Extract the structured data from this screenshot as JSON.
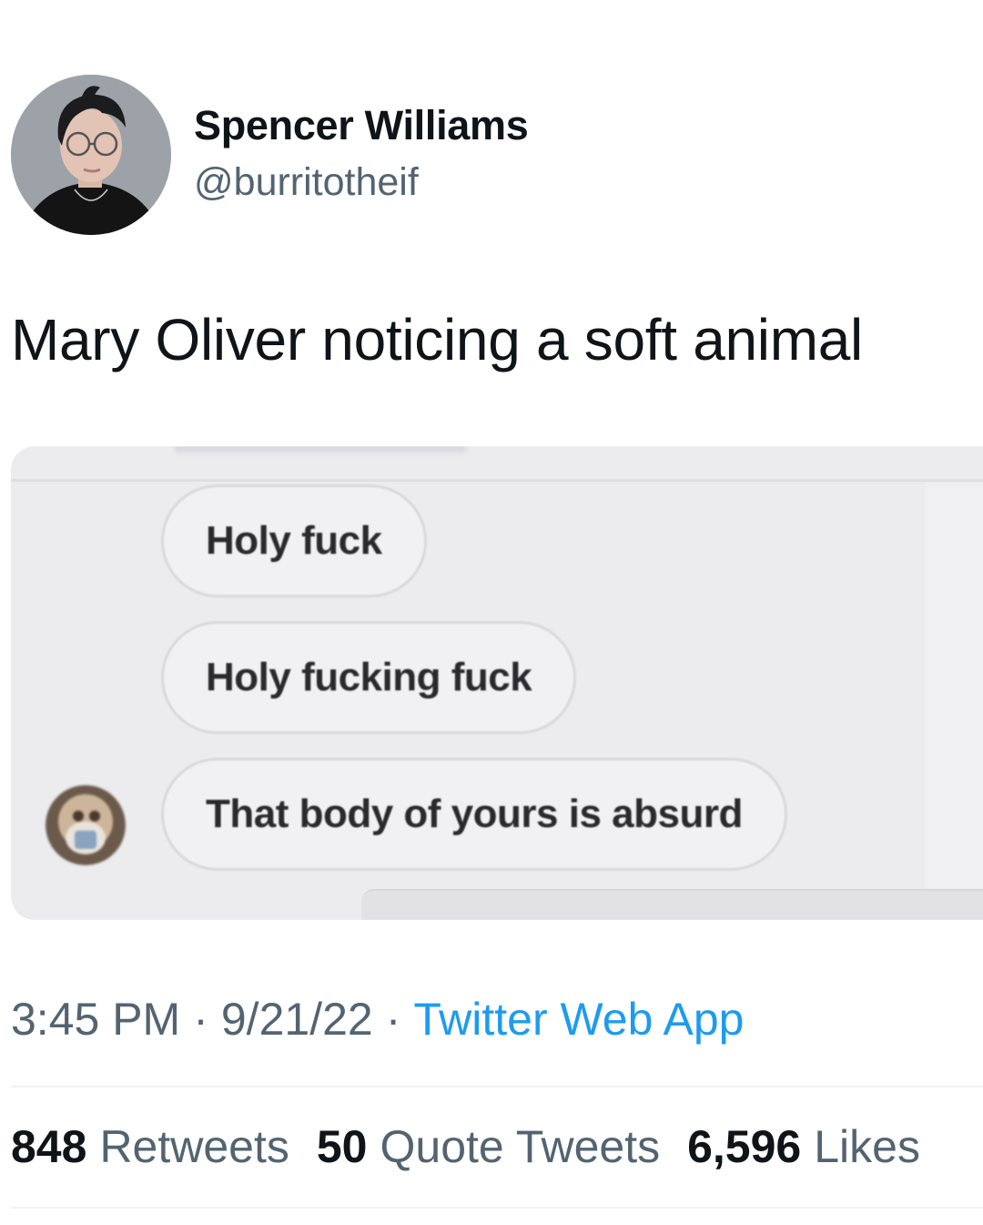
{
  "author": {
    "display_name": "Spencer Williams",
    "handle": "@burritotheif"
  },
  "tweet": {
    "text": "Mary Oliver noticing a soft animal"
  },
  "media": {
    "messages": [
      "Holy fuck",
      "Holy fucking fuck",
      "That body of yours is absurd"
    ]
  },
  "meta": {
    "time": "3:45 PM",
    "separator": "·",
    "date": "9/21/22",
    "source": "Twitter Web App"
  },
  "stats": {
    "retweets_count": "848",
    "retweets_label": "Retweets",
    "quotes_count": "50",
    "quotes_label": "Quote Tweets",
    "likes_count": "6,596",
    "likes_label": "Likes"
  },
  "colors": {
    "text_primary": "#0f1419",
    "text_secondary": "#536471",
    "link": "#1d9bf0"
  }
}
